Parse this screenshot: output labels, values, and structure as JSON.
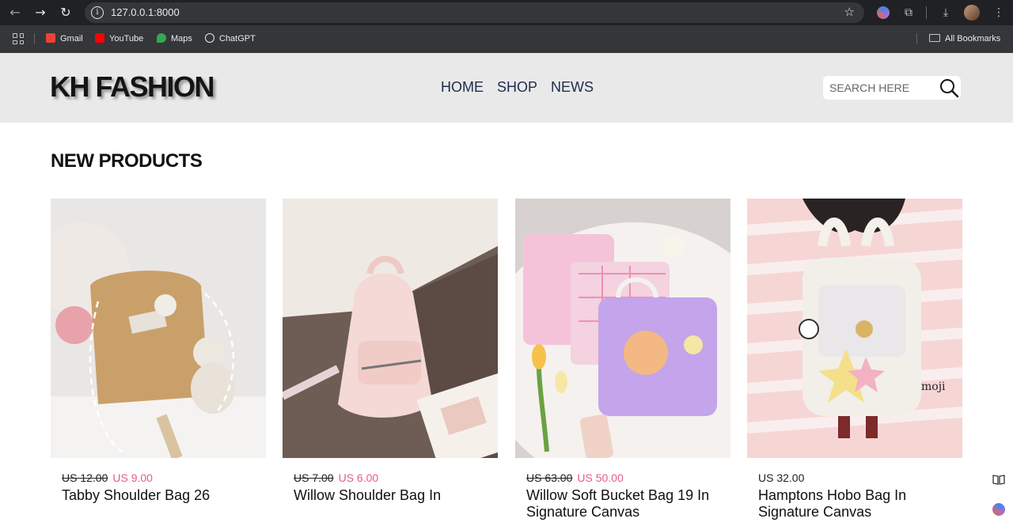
{
  "browser": {
    "url": "127.0.0.1:8000",
    "bookmarks": [
      {
        "label": "Gmail",
        "icon": "gmail-icon",
        "color": "#ea4335"
      },
      {
        "label": "YouTube",
        "icon": "youtube-icon",
        "color": "#ff0000"
      },
      {
        "label": "Maps",
        "icon": "maps-icon",
        "color": "#34a853"
      },
      {
        "label": "ChatGPT",
        "icon": "chatgpt-icon",
        "color": "#e8eaed"
      }
    ],
    "all_bookmarks": "All Bookmarks"
  },
  "header": {
    "logo": "KH FASHION",
    "nav": [
      "HOME",
      "SHOP",
      "NEWS"
    ],
    "search_placeholder": "SEARCH HERE"
  },
  "section": {
    "title": "NEW PRODUCTS"
  },
  "products": [
    {
      "old_price": "US 12.00",
      "price": "US 9.00",
      "name": "Tabby Shoulder Bag 26",
      "image_colors": [
        "#e9e6e3",
        "#c9a068"
      ]
    },
    {
      "old_price": "US 7.00",
      "price": "US 6.00",
      "name": "Willow Shoulder Bag In",
      "image_colors": [
        "#6b5a52",
        "#f2d3d0"
      ]
    },
    {
      "old_price": "US 63.00",
      "price": "US 50.00",
      "name": "Willow Soft Bucket Bag 19 In Signature Canvas",
      "image_colors": [
        "#d9d5d2",
        "#b89be0"
      ]
    },
    {
      "old_price": "",
      "price": "US 32.00",
      "name": "Hamptons Hobo Bag In Signature Canvas",
      "image_colors": [
        "#f3c9c9",
        "#eeeeea"
      ]
    }
  ],
  "colors": {
    "header_bg": "#e9e9e9",
    "nav_text": "#1f2d4d",
    "sale_price": "#e85a8a"
  }
}
